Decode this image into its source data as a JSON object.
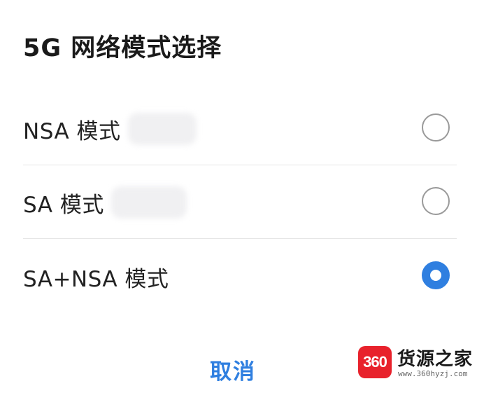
{
  "dialog": {
    "title": "5G 网络模式选择",
    "options": [
      {
        "label": "NSA 模式",
        "selected": false
      },
      {
        "label": "SA 模式",
        "selected": false
      },
      {
        "label": "SA+NSA 模式",
        "selected": true
      }
    ],
    "cancel_label": "取消"
  },
  "watermark": {
    "badge": "360",
    "name": "货源之家",
    "url": "www.360hyzj.com"
  },
  "colors": {
    "accent": "#2f7fe0",
    "watermark_red": "#e8222c"
  }
}
